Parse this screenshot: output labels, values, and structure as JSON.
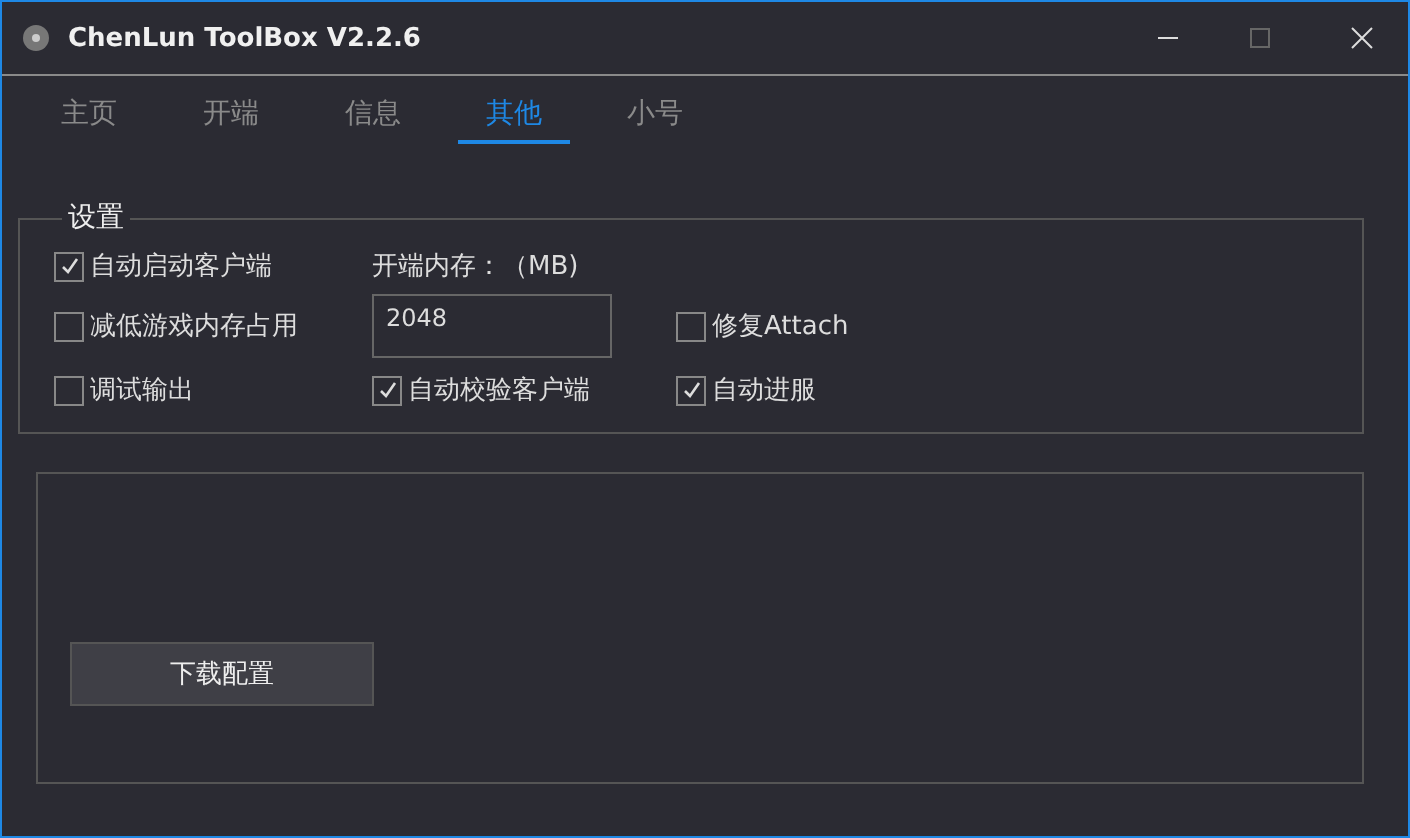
{
  "window": {
    "title": "ChenLun ToolBox V2.2.6"
  },
  "tabs": [
    {
      "label": "主页",
      "selected": false
    },
    {
      "label": "开端",
      "selected": false
    },
    {
      "label": "信息",
      "selected": false
    },
    {
      "label": "其他",
      "selected": true
    },
    {
      "label": "小号",
      "selected": false
    }
  ],
  "settings": {
    "title": "设置",
    "rows": [
      [
        {
          "kind": "checkbox",
          "label": "自动启动客户端",
          "checked": true
        },
        {
          "kind": "label",
          "label": "开端内存：（MB)"
        }
      ],
      [
        {
          "kind": "checkbox",
          "label": "减低游戏内存占用",
          "checked": false
        },
        {
          "kind": "field",
          "value": "2048"
        },
        {
          "kind": "checkbox",
          "label": "修复Attach",
          "checked": false
        }
      ],
      [
        {
          "kind": "checkbox",
          "label": "调试输出",
          "checked": false
        },
        {
          "kind": "checkbox",
          "label": "自动校验客户端",
          "checked": true
        },
        {
          "kind": "checkbox",
          "label": "自动进服",
          "checked": true
        }
      ]
    ]
  },
  "download_button": "下载配置"
}
